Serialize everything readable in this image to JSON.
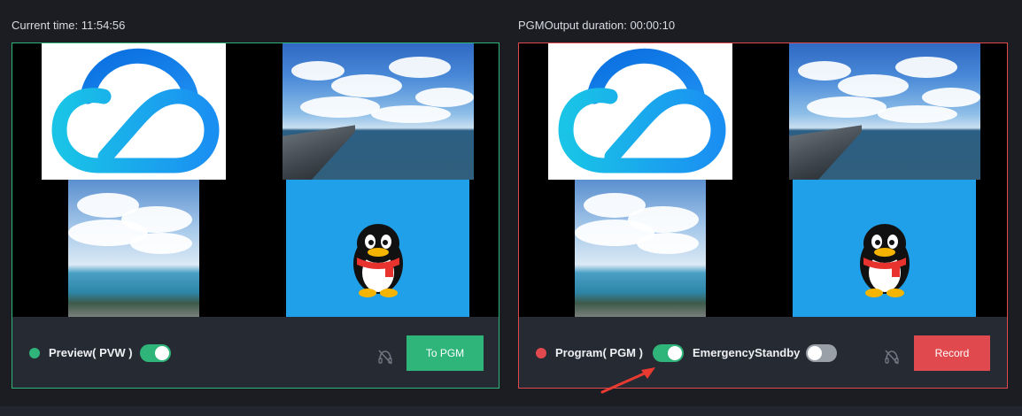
{
  "header": {
    "current_time_label": "Current time: 11:54:56",
    "pgm_duration_label": "PGMOutput duration: 00:00:10"
  },
  "preview_panel": {
    "label": "Preview( PVW )",
    "toggle_on": true,
    "button_label": "To PGM",
    "status_color": "#2fb57a",
    "border_color": "#2fb57a"
  },
  "program_panel": {
    "label": "Program( PGM )",
    "toggle_on": true,
    "emergency_label": "EmergencyStandby",
    "emergency_toggle_on": false,
    "button_label": "Record",
    "status_color": "#e0494d",
    "border_color": "#e0494d"
  },
  "icons": {
    "logo": "cloud-logo-icon",
    "penguin": "penguin-icon",
    "mute": "mute-audio-icon",
    "annotation": "red-arrow-annotation"
  },
  "colors": {
    "accent_green": "#2fb57a",
    "accent_red": "#e0494d",
    "background": "#1b1d23",
    "panel": "#262a33",
    "qq_tile": "#1fa0e9"
  }
}
